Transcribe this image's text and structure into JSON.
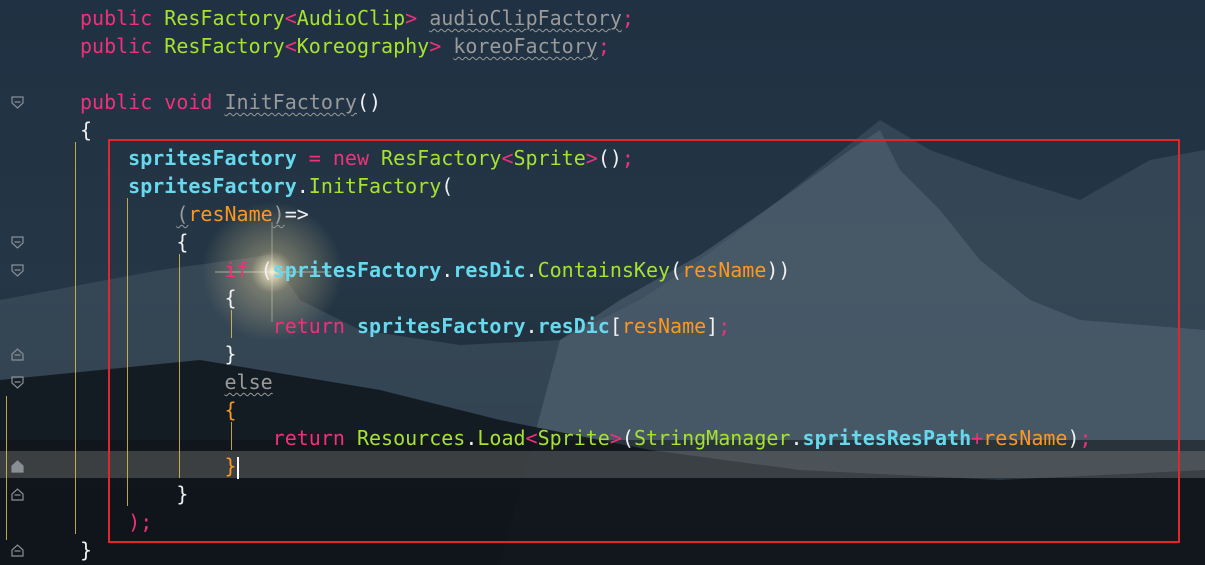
{
  "editor": {
    "lines": [
      [
        {
          "t": "public ",
          "c": "kw"
        },
        {
          "t": "ResFactory",
          "c": "type"
        },
        {
          "t": "<",
          "c": "angle"
        },
        {
          "t": "AudioClip",
          "c": "type"
        },
        {
          "t": "> ",
          "c": "angle"
        },
        {
          "t": "audioClipFactory",
          "c": "dim",
          "u": true
        },
        {
          "t": ";",
          "c": "kw"
        }
      ],
      [
        {
          "t": "public ",
          "c": "kw"
        },
        {
          "t": "ResFactory",
          "c": "type"
        },
        {
          "t": "<",
          "c": "angle"
        },
        {
          "t": "Koreography",
          "c": "type"
        },
        {
          "t": "> ",
          "c": "angle"
        },
        {
          "t": "koreoFactory",
          "c": "dim",
          "u": true
        },
        {
          "t": ";",
          "c": "kw"
        }
      ],
      [],
      [
        {
          "t": "public ",
          "c": "kw"
        },
        {
          "t": "void ",
          "c": "kw"
        },
        {
          "t": "InitFactory",
          "c": "dim",
          "u": true
        },
        {
          "t": "()",
          "c": "punc"
        }
      ],
      [
        {
          "t": "{",
          "c": "punc"
        }
      ],
      [
        {
          "t": "    "
        },
        {
          "t": "spritesFactory",
          "c": "field"
        },
        {
          "t": " = ",
          "c": "kw"
        },
        {
          "t": "new ",
          "c": "kw"
        },
        {
          "t": "ResFactory",
          "c": "type"
        },
        {
          "t": "<",
          "c": "angle"
        },
        {
          "t": "Sprite",
          "c": "type"
        },
        {
          "t": ">",
          "c": "angle"
        },
        {
          "t": "()",
          "c": "punc"
        },
        {
          "t": ";",
          "c": "kw"
        }
      ],
      [
        {
          "t": "    "
        },
        {
          "t": "spritesFactory",
          "c": "field"
        },
        {
          "t": ".",
          "c": "punc"
        },
        {
          "t": "InitFactory",
          "c": "method"
        },
        {
          "t": "(",
          "c": "punc"
        }
      ],
      [
        {
          "t": "        "
        },
        {
          "t": "(",
          "c": "dim",
          "u": true
        },
        {
          "t": "resName",
          "c": "param"
        },
        {
          "t": ")",
          "c": "dim",
          "u": true
        },
        {
          "t": "=>",
          "c": "punc"
        }
      ],
      [
        {
          "t": "        "
        },
        {
          "t": "{",
          "c": "punc"
        }
      ],
      [
        {
          "t": "            "
        },
        {
          "t": "if ",
          "c": "kw"
        },
        {
          "t": "(",
          "c": "punc"
        },
        {
          "t": "spritesFactory",
          "c": "field"
        },
        {
          "t": ".",
          "c": "punc"
        },
        {
          "t": "resDic",
          "c": "field"
        },
        {
          "t": ".",
          "c": "punc"
        },
        {
          "t": "ContainsKey",
          "c": "method"
        },
        {
          "t": "(",
          "c": "punc"
        },
        {
          "t": "resName",
          "c": "param"
        },
        {
          "t": "))",
          "c": "punc"
        }
      ],
      [
        {
          "t": "            "
        },
        {
          "t": "{",
          "c": "punc"
        }
      ],
      [
        {
          "t": "                "
        },
        {
          "t": "return ",
          "c": "kw"
        },
        {
          "t": "spritesFactory",
          "c": "field"
        },
        {
          "t": ".",
          "c": "punc"
        },
        {
          "t": "resDic",
          "c": "field"
        },
        {
          "t": "[",
          "c": "punc"
        },
        {
          "t": "resName",
          "c": "param"
        },
        {
          "t": "]",
          "c": "punc"
        },
        {
          "t": ";",
          "c": "kw"
        }
      ],
      [
        {
          "t": "            "
        },
        {
          "t": "}",
          "c": "punc"
        }
      ],
      [
        {
          "t": "            "
        },
        {
          "t": "else",
          "c": "dim",
          "u": true
        }
      ],
      [
        {
          "t": "            "
        },
        {
          "t": "{",
          "c": "param"
        }
      ],
      [
        {
          "t": "                "
        },
        {
          "t": "return ",
          "c": "kw"
        },
        {
          "t": "Resources",
          "c": "type"
        },
        {
          "t": ".",
          "c": "punc"
        },
        {
          "t": "Load",
          "c": "method"
        },
        {
          "t": "<",
          "c": "angle"
        },
        {
          "t": "Sprite",
          "c": "type"
        },
        {
          "t": ">",
          "c": "angle"
        },
        {
          "t": "(",
          "c": "punc"
        },
        {
          "t": "StringManager",
          "c": "type"
        },
        {
          "t": ".",
          "c": "punc"
        },
        {
          "t": "spritesResPath",
          "c": "field"
        },
        {
          "t": "+",
          "c": "kw"
        },
        {
          "t": "resName",
          "c": "param"
        },
        {
          "t": ")",
          "c": "punc"
        },
        {
          "t": ";",
          "c": "kw"
        }
      ],
      [
        {
          "t": "            "
        },
        {
          "t": "}",
          "c": "param"
        },
        {
          "caret": true
        }
      ],
      [
        {
          "t": "        "
        },
        {
          "t": "}",
          "c": "punc"
        }
      ],
      [
        {
          "t": "    "
        },
        {
          "t": ");",
          "c": "kw"
        }
      ],
      [
        {
          "t": "}",
          "c": "punc"
        }
      ]
    ],
    "fold_markers": [
      {
        "line": 3,
        "kind": "fold-open"
      },
      {
        "line": 8,
        "kind": "fold-open"
      },
      {
        "line": 9,
        "kind": "fold-open"
      },
      {
        "line": 12,
        "kind": "fold-close"
      },
      {
        "line": 13,
        "kind": "fold-open"
      },
      {
        "line": 16,
        "kind": "fold-close"
      },
      {
        "line": 17,
        "kind": "fold-close"
      },
      {
        "line": 19,
        "kind": "fold-close"
      }
    ],
    "current_line": 16,
    "highlight_color": "#e0282c"
  }
}
